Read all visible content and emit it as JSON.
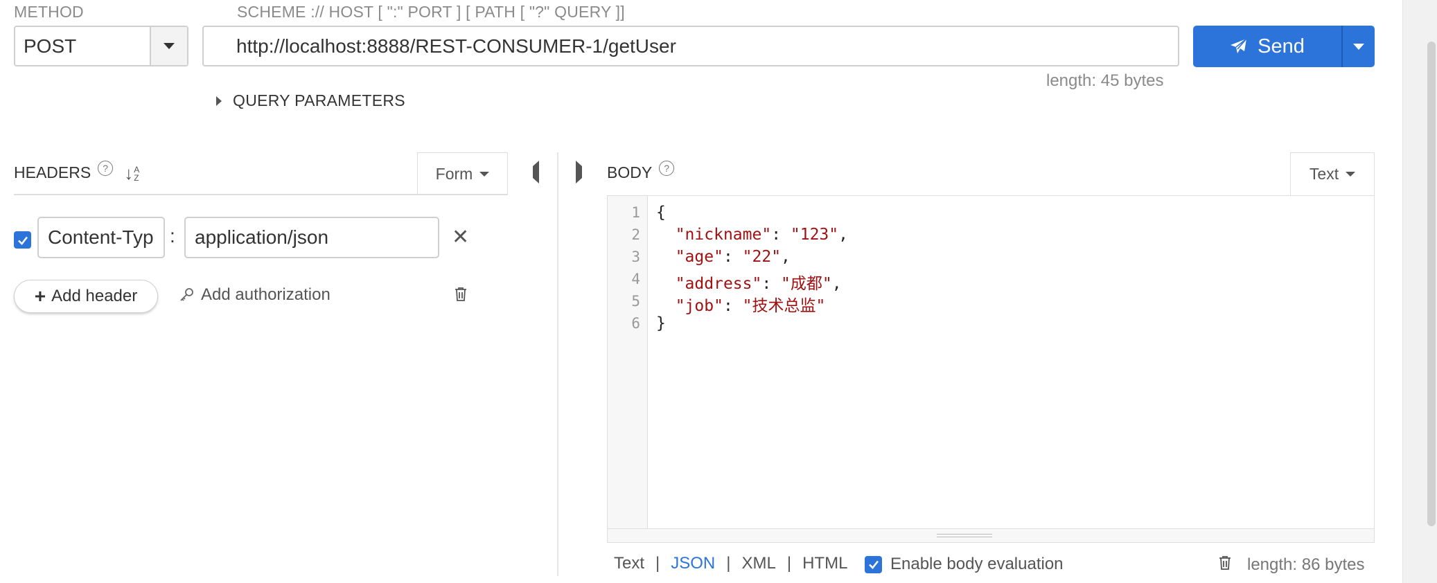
{
  "labels": {
    "method": "METHOD",
    "url_hint": "SCHEME :// HOST [ \":\" PORT ] [ PATH [ \"?\" QUERY ]]"
  },
  "request": {
    "method": "POST",
    "url": "http://localhost:8888/REST-CONSUMER-1/getUser",
    "url_length": "length: 45 bytes",
    "send_label": "Send",
    "query_parameters_label": "QUERY PARAMETERS"
  },
  "headers_panel": {
    "title": "HEADERS",
    "help": "?",
    "sort_a": "A",
    "sort_z": "Z",
    "mode": "Form",
    "rows": [
      {
        "enabled": true,
        "name": "Content-Typ",
        "value": "application/json"
      }
    ],
    "colon": ":",
    "remove_glyph": "✕",
    "add_header_label": "Add header",
    "add_authorization_label": "Add authorization"
  },
  "body_panel": {
    "title": "BODY",
    "help": "?",
    "mode": "Text",
    "line_numbers": [
      "1",
      "2",
      "3",
      "4",
      "5",
      "6"
    ],
    "code": {
      "open": "{",
      "close": "}",
      "fields": [
        {
          "key": "\"nickname\"",
          "value": "\"123\"",
          "comma": ","
        },
        {
          "key": "\"age\"",
          "value": "\"22\"",
          "comma": ","
        },
        {
          "key": "\"address\"",
          "value": "\"成都\"",
          "comma": ","
        },
        {
          "key": "\"job\"",
          "value": "\"技术总监\"",
          "comma": ""
        }
      ]
    },
    "formats": [
      "Text",
      "JSON",
      "XML",
      "HTML"
    ],
    "active_format": "JSON",
    "separator": "|",
    "enable_body_evaluation_label": "Enable body evaluation",
    "enable_body_evaluation": true,
    "length": "length: 86 bytes"
  },
  "colors": {
    "accent": "#2d74da",
    "string": "#a11111",
    "border": "#cfcfcf"
  }
}
